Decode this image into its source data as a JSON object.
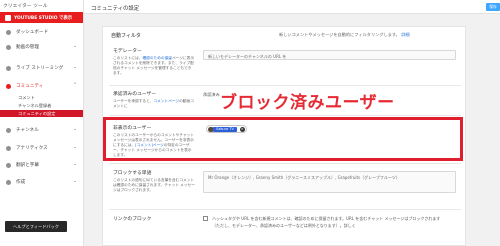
{
  "sidebar": {
    "header": "クリエイター ツール",
    "studio_label": "YOUTUBE STUDIO で表示",
    "items": [
      {
        "label": "ダッシュボード",
        "icon": "dashboard-icon",
        "chevron": ""
      },
      {
        "label": "動画の管理",
        "icon": "video-icon",
        "chevron": "⌄"
      },
      {
        "label": "ライブ ストリーミング",
        "icon": "live-icon",
        "chevron": "⌄"
      },
      {
        "label": "コミュニティ",
        "icon": "community-icon",
        "chevron": "⌃"
      },
      {
        "label": "チャンネル",
        "icon": "channel-icon",
        "chevron": "⌄"
      },
      {
        "label": "アナリティクス",
        "icon": "analytics-icon",
        "chevron": "⌄"
      },
      {
        "label": "翻訳と字幕",
        "icon": "translate-icon",
        "chevron": "⌄"
      },
      {
        "label": "作成",
        "icon": "create-icon",
        "chevron": "⌄"
      }
    ],
    "sub_items": [
      "コメント",
      "チャンネル登録者",
      "コミュニティの設定"
    ],
    "feedback_label": "ヘルプとフィードバック"
  },
  "topbar": {
    "title": "コミュニティの設定",
    "save_label": "保存"
  },
  "panel": {
    "section_title": "自動フィルタ",
    "section_desc": "新しいコメントやメッセージを自動的にフィルタリングします。",
    "section_link": "詳細",
    "moderators": {
      "label": "モデレーター",
      "desc": "このリストには、",
      "desc_link": "確認のための保留",
      "desc_rest": "ページに表示されるコメントを削除できます。また、ライブ配信のチャット メッセージを管理することもできます。",
      "placeholder": "新しいモデレーターのチャンネルの URL を"
    },
    "approved": {
      "label": "承認済みのユーザー",
      "desc": "ユーザーを承認すると、",
      "desc_link": "コメントページ",
      "desc_rest": "の動画コメントに",
      "value": "承認済み"
    },
    "hidden": {
      "label": "非表示のユーザー",
      "desc": "このリストのユーザーからのコメントやチャット メッセージは表示されません。ユーザーを非表示にするには、",
      "desc_link": "[コメント]ページ",
      "desc_rest": "の特定のユーザー、チャット メッセージからのコメントを表示します。",
      "chip_name": "Sakura TV",
      "chip_remove": "×"
    },
    "blocked_words": {
      "label": "ブロックする単語",
      "desc": "このリストの語句に似ている言葉を含むコメントは確認のために保留されます。チャット メッセージはブロックされます。",
      "value": "Mr Orange（オレンジ）, Granny Smith（グラニースミスアップル）, Grapefruits（グレープフルーツ）"
    },
    "link_block": {
      "label": "リンクのブロック",
      "line1": "ハッシュタグや URL を含む新規コメントは、確認のために保留されます。URL を含むチャット メッセージはブロックされます",
      "line2": "（ただし、モデレーター、承認済みのユーザーなどは例外となります）。詳しく"
    }
  },
  "annotation": "ブロック済みユーザー"
}
